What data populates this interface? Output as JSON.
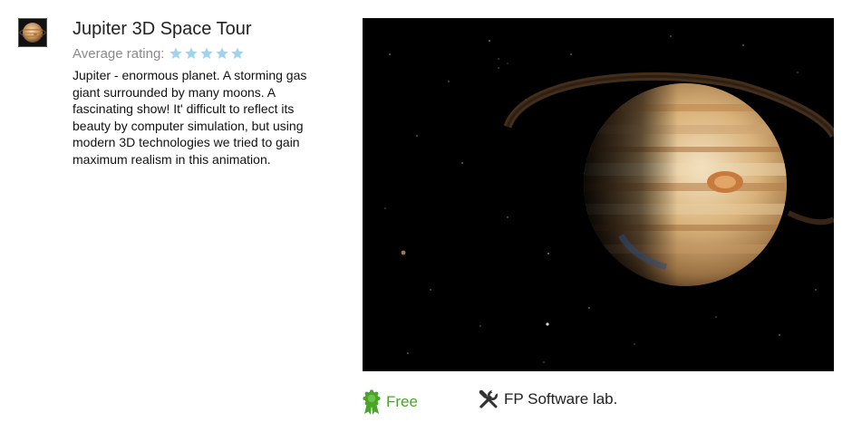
{
  "app": {
    "title": "Jupiter 3D Space Tour",
    "rating_label": "Average rating:",
    "rating_stars": 5,
    "rating_max": 5,
    "description": "Jupiter - enormous planet. A storming gas giant surrounded by many moons. A fascinating show! It' difficult to reflect its beauty by computer simulation, but using modern 3D technologies we tried to gain maximum realism in this animation."
  },
  "meta": {
    "price": "Free",
    "developer": "FP Software lab."
  },
  "colors": {
    "star": "#9fd3ef",
    "price": "#4aa42a",
    "rating_label": "#8a8a8a"
  },
  "icons": {
    "app": "jupiter-app-icon",
    "star": "star-icon",
    "price": "award-ribbon-icon",
    "developer": "tools-icon"
  }
}
